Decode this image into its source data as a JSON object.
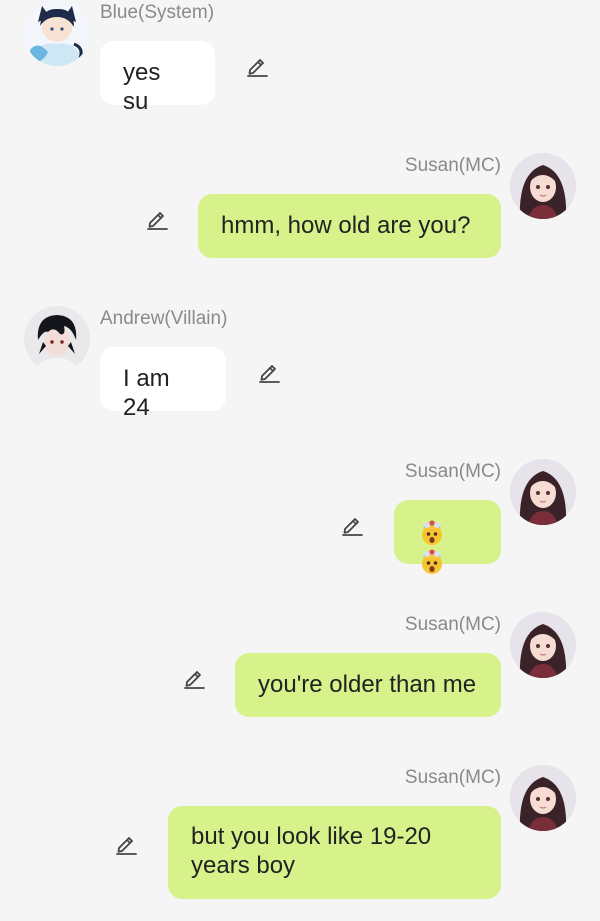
{
  "messages": [
    {
      "id": "m1",
      "side": "incoming",
      "sender": "Blue(System)",
      "avatar": "blue-boy-avatar",
      "text": "yes su"
    },
    {
      "id": "m2",
      "side": "outgoing",
      "sender": "Susan(MC)",
      "avatar": "susan-avatar",
      "text": "hmm, how old are you?"
    },
    {
      "id": "m3",
      "side": "incoming",
      "sender": "Andrew(Villain)",
      "avatar": "andrew-avatar",
      "text": "I am 24"
    },
    {
      "id": "m4",
      "side": "outgoing",
      "sender": "Susan(MC)",
      "avatar": "susan-avatar",
      "text": "",
      "emojis": [
        "exploding-head-emoji",
        "exploding-head-emoji"
      ]
    },
    {
      "id": "m5",
      "side": "outgoing",
      "sender": "Susan(MC)",
      "avatar": "susan-avatar",
      "text": "you're older than me"
    },
    {
      "id": "m6",
      "side": "outgoing",
      "sender": "Susan(MC)",
      "avatar": "susan-avatar",
      "text_lines": [
        "but you look like 19-20",
        "years boy"
      ]
    }
  ],
  "icons": {
    "edit": "pencil-edit-icon"
  },
  "colors": {
    "background": "#f5f5f5",
    "incoming_bubble": "#ffffff",
    "outgoing_bubble": "#d7f28b",
    "sender_name": "#8a8a8a",
    "text": "#222222"
  }
}
